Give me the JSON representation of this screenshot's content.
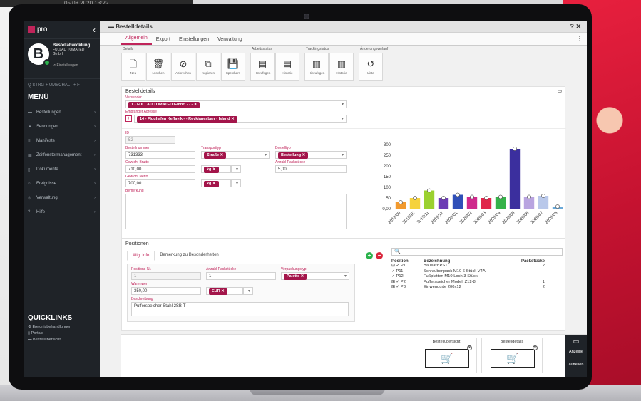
{
  "top_strip": {
    "date_text": "05.08.2020 13:22"
  },
  "app": {
    "logo_text": "pro",
    "collapse_icon": "chevron-left-icon",
    "window_title": "Bestelldetails",
    "window_controls": "? ✕"
  },
  "profile": {
    "initial": "B",
    "name": "Bestellabwicklung",
    "company": "FULLAU TOMATED GmbH",
    "settings_label": "Einstellungen"
  },
  "sidebar": {
    "search_hint": "STRG + UMSCHALT + F",
    "menu_title": "MENÜ",
    "items": [
      {
        "icon": "truck-icon",
        "glyph": "▬",
        "label": "Bestellungen"
      },
      {
        "icon": "car-icon",
        "glyph": "▲",
        "label": "Sendungen"
      },
      {
        "icon": "list-icon",
        "glyph": "≡",
        "label": "Manifeste"
      },
      {
        "icon": "grid-icon",
        "glyph": "▦",
        "label": "Zeitfenstermanagement"
      },
      {
        "icon": "document-icon",
        "glyph": "▯",
        "label": "Dokumente"
      },
      {
        "icon": "bell-icon",
        "glyph": "○",
        "label": "Ereignisse"
      },
      {
        "icon": "gear-icon",
        "glyph": "⚙",
        "label": "Verwaltung"
      },
      {
        "icon": "help-icon",
        "glyph": "?",
        "label": "Hilfe"
      }
    ],
    "quicklinks_title": "QUICKLINKS",
    "quicklinks": [
      {
        "icon": "gear-icon",
        "glyph": "⚙",
        "label": "Ereignisbehandlungen"
      },
      {
        "icon": "document-icon",
        "glyph": "▯",
        "label": "Portale"
      },
      {
        "icon": "cart-icon",
        "glyph": "▬",
        "label": "Bestellübersicht"
      }
    ]
  },
  "tabs": [
    "Allgemein",
    "Export",
    "Einstellungen",
    "Verwaltung"
  ],
  "ribbon": {
    "groups": [
      {
        "label": "Details",
        "buttons": [
          {
            "icon": "new-file-icon",
            "glyph": "🗋",
            "label": "Neu"
          },
          {
            "icon": "trash-icon",
            "glyph": "🗑",
            "label": "Löschen"
          },
          {
            "icon": "cancel-icon",
            "glyph": "⊘",
            "label": "Abbrechen"
          },
          {
            "icon": "copy-icon",
            "glyph": "⧉",
            "label": "Kopieren"
          },
          {
            "icon": "save-icon",
            "glyph": "💾",
            "label": "Speichern"
          }
        ]
      },
      {
        "label": "Arbeitsstatus",
        "buttons": [
          {
            "icon": "status-add-icon",
            "glyph": "▤",
            "label": "Hinzufügen"
          },
          {
            "icon": "status-history-icon",
            "glyph": "▤",
            "label": "Historie"
          }
        ]
      },
      {
        "label": "Trackingstatus",
        "buttons": [
          {
            "icon": "tracking-add-icon",
            "glyph": "▥",
            "label": "Hinzufügen"
          },
          {
            "icon": "tracking-history-icon",
            "glyph": "▥",
            "label": "Historie"
          }
        ]
      },
      {
        "label": "Änderungsverlauf",
        "buttons": [
          {
            "icon": "history-icon",
            "glyph": "↺",
            "label": "Liste"
          }
        ]
      }
    ]
  },
  "details": {
    "section_title": "Bestelldetails",
    "sender_label": "Versender",
    "sender_value": "1 - FULLAU TOMATED GmbH - - - ✕",
    "recipient_label": "Empfänger Adresse",
    "recipient_value": "14 - Flughafen Keflavík - - Reykjanesbær - Island ✕",
    "id_label": "ID",
    "id_value": "52",
    "order_no_label": "Bestellnummer",
    "order_no_value": "731333",
    "transport_label": "Transporttyp",
    "transport_value": "Straße ✕",
    "order_type_label": "Bestelltyp",
    "order_type_value": "Bestellung ✕",
    "gross_label": "Gewicht Brutto",
    "gross_value": "710,00",
    "gross_unit": "kg ✕",
    "pieces_label": "Anzahl Packstücke",
    "pieces_value": "5,00",
    "net_label": "Gewicht Netto",
    "net_value": "700,00",
    "net_unit": "kg ✕",
    "remark_label": "Bemerkung"
  },
  "chart_data": {
    "type": "bar",
    "categories": [
      "2019/09",
      "2019/10",
      "2019/11",
      "2019/12",
      "2020/01",
      "2020/02",
      "2020/03",
      "2020/04",
      "2020/05",
      "2020/06",
      "2020/07",
      "2020/08"
    ],
    "values": [
      30,
      50,
      85,
      50,
      65,
      55,
      50,
      55,
      280,
      55,
      60,
      10
    ],
    "colors": [
      "#f29a2e",
      "#f5d23c",
      "#9bd12f",
      "#6c3bb5",
      "#2f4fb8",
      "#cf2a8c",
      "#e0264b",
      "#35b24a",
      "#3b2f9e",
      "#b9a4e0",
      "#b9c8ea",
      "#6aa9d8"
    ],
    "yticks": [
      "300",
      "250",
      "200",
      "150",
      "100",
      "50",
      "0,00"
    ],
    "ylim": [
      0,
      300
    ]
  },
  "positions": {
    "title": "Positionen",
    "tabs": [
      "Allg. Info",
      "Bemerkung zu Besonderheiten"
    ],
    "pos_no_label": "Positions-Nr.",
    "pos_no_value": "1",
    "pieces_label": "Anzahl Packstücke",
    "pieces_value": "1",
    "packaging_label": "Verpackungstyp",
    "packaging_value": "Palette ✕",
    "goods_value_label": "Warenwert",
    "goods_value": "350,00",
    "currency": "EUR ✕",
    "description_label": "Beschreibung",
    "description_value": "Pufferspeicher Stahl 2SB-T"
  },
  "tree": {
    "search_icon": "search-icon",
    "search_glyph": "🔍",
    "headers": [
      "Position",
      "Bezeichnung",
      "Packstücke"
    ],
    "rows": [
      {
        "pos": "⊟ ✓ P1",
        "name": "Bausatz PS1",
        "qty": "2"
      },
      {
        "pos": "   ✓ P11",
        "name": "Schraubenpack M10 6 Stück V4A",
        "qty": ""
      },
      {
        "pos": "   ✓ P12",
        "name": "Fußplatten M10 Loch 3 Stück",
        "qty": ""
      },
      {
        "pos": "⊞ ✓ P2",
        "name": "Pufferspeicher Modell Z12-8",
        "qty": "1"
      },
      {
        "pos": "⊞ ✓ P3",
        "name": "Einweggurte 200x12",
        "qty": "2"
      }
    ]
  },
  "quick": {
    "card1_title": "Bestellübersicht",
    "card2_title": "Bestelldetails",
    "card1_icon": "🛒",
    "card2_icon": "🛒",
    "side_label1": "Anzeige",
    "side_label2": "aufteilen"
  }
}
